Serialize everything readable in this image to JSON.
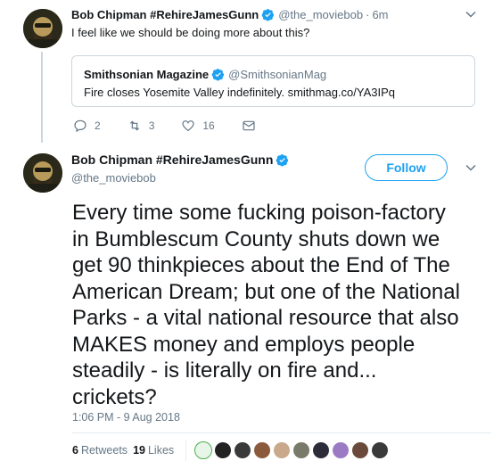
{
  "tweet1": {
    "name": "Bob Chipman #RehireJamesGunn",
    "handle": "@the_moviebob",
    "separator": "·",
    "time": "6m",
    "text": "I feel like we should be doing more about this?",
    "avatar_icon": "user-avatar",
    "quote": {
      "name": "Smithsonian Magazine",
      "handle": "@SmithsonianMag",
      "text": "Fire closes Yosemite Valley indefinitely. smithmag.co/YA3IPq"
    },
    "actions": {
      "replies": "2",
      "retweets": "3",
      "likes": "16"
    }
  },
  "tweet2": {
    "name": "Bob Chipman #RehireJamesGunn",
    "handle": "@the_moviebob",
    "follow_label": "Follow",
    "body": "Every time some fucking poison-factory\nin Bumblescum County shuts down we\nget 90 thinkpieces about the End of The\nAmerican Dream; but one of the National\nParks - a vital national resource that also\nMAKES money and employs people\nsteadily - is literally on fire and...\ncrickets?",
    "timestamp": "1:06 PM - 9 Aug 2018",
    "retweet_count": "6",
    "retweet_label": "Retweets",
    "like_count": "19",
    "like_label": "Likes",
    "liker_colors": [
      "#e8f5e9",
      "#222222",
      "#3a3a3a",
      "#8b5a3c",
      "#c9a98a",
      "#7a7a6a",
      "#2d2d3a",
      "#9b7bc4",
      "#6a4a3a",
      "#3a3a3a"
    ]
  },
  "colors": {
    "accent": "#1da1f2",
    "muted": "#657786",
    "border": "#ccd6dd"
  }
}
